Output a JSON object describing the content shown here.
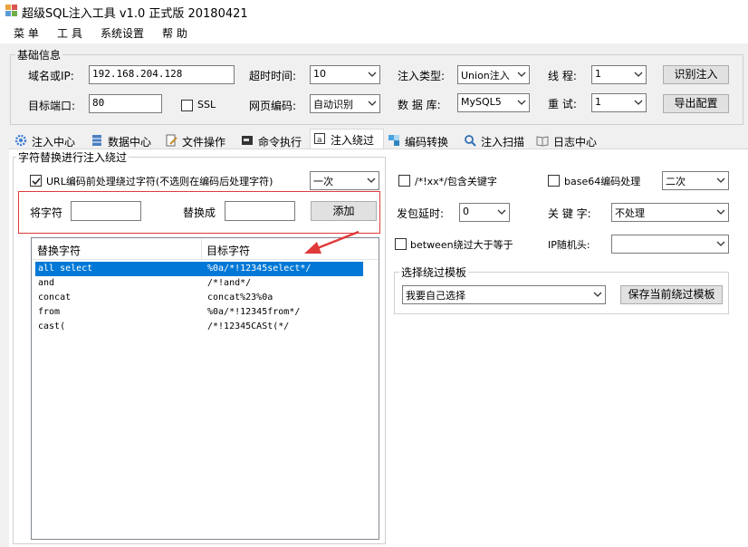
{
  "window": {
    "title": "超级SQL注入工具 v1.0 正式版 20180421"
  },
  "menu": [
    "菜 单",
    "工 具",
    "系统设置",
    "帮 助"
  ],
  "basic": {
    "group_title": "基础信息",
    "domain_label": "域名或IP:",
    "domain_value": "192.168.204.128",
    "port_label": "目标端口:",
    "port_value": "80",
    "ssl_label": "SSL",
    "timeout_label": "超时时间:",
    "timeout_value": "10",
    "encoding_label": "网页编码:",
    "encoding_value": "自动识别",
    "inject_type_label": "注入类型:",
    "inject_type_value": "Union注入",
    "db_label": "数 据 库:",
    "db_value": "MySQL5",
    "threads_label": "线 程:",
    "threads_value": "1",
    "retry_label": "重 试:",
    "retry_value": "1",
    "identify_button": "识别注入",
    "export_button": "导出配置"
  },
  "tabs": [
    {
      "label": "注入中心",
      "icon": "gear-icon"
    },
    {
      "label": "数据中心",
      "icon": "database-icon"
    },
    {
      "label": "文件操作",
      "icon": "edit-file-icon"
    },
    {
      "label": "命令执行",
      "icon": "terminal-icon"
    },
    {
      "label": "注入绕过",
      "icon": "bypass-icon"
    },
    {
      "label": "编码转换",
      "icon": "convert-icon"
    },
    {
      "label": "注入扫描",
      "icon": "magnifier-icon"
    },
    {
      "label": "日志中心",
      "icon": "book-icon"
    }
  ],
  "bypass": {
    "group_title": "字符替换进行注入绕过",
    "url_encode_label": "URL编码前处理绕过字符(不选则在编码后处理字符)",
    "url_encode_times": "一次",
    "replace_from_label": "将字符",
    "replace_to_label": "替换成",
    "add_button": "添加",
    "columns": [
      "替换字符",
      "目标字符"
    ],
    "rows": [
      [
        "all select",
        "%0a/*!12345select*/"
      ],
      [
        "and",
        "/*!and*/"
      ],
      [
        "concat",
        "concat%23%0a"
      ],
      [
        "from",
        "%0a/*!12345from*/"
      ],
      [
        "cast(",
        "/*!12345CASt(*/"
      ]
    ],
    "comment_label": "/*!xx*/包含关键字",
    "base64_label": "base64编码处理",
    "base64_times": "二次",
    "delay_label": "发包延时:",
    "delay_value": "0",
    "keyword_label": "关 键 字:",
    "keyword_value": "不处理",
    "between_label": "between绕过大于等于",
    "ip_label": "IP随机头:",
    "ip_value": "",
    "template_group_title": "选择绕过模板",
    "template_value": "我要自己选择",
    "save_template_button": "保存当前绕过模板"
  },
  "colors": {
    "selection": "#0078d7",
    "highlight_box": "#e03a3a",
    "arrow": "#e03a3a"
  }
}
